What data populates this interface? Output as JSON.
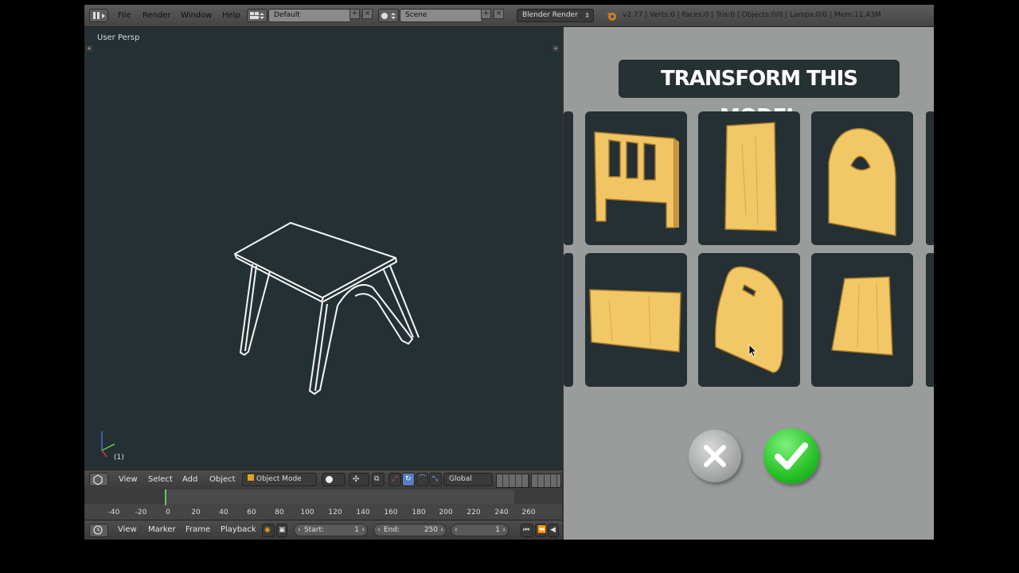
{
  "app": {
    "menus": [
      "File",
      "Render",
      "Window",
      "Help"
    ],
    "screen_layout": "Default",
    "scene": "Scene",
    "render_engine": "Blender Render",
    "stats": "v2.77 | Verts:0 | Faces:0 | Tris:0 | Objects:0/0 | Lamps:0/0 | Mem:11.43M"
  },
  "viewport": {
    "label": "User Persp",
    "frame_indicator": "(1)"
  },
  "header3d": {
    "view": "View",
    "select": "Select",
    "add": "Add",
    "object": "Object",
    "mode": "Object Mode",
    "orientation": "Global"
  },
  "timeline": {
    "ticks": [
      "-40",
      "-20",
      "0",
      "20",
      "40",
      "60",
      "80",
      "100",
      "120",
      "140",
      "160",
      "180",
      "200",
      "220",
      "240",
      "260"
    ],
    "current_frame_value": 0
  },
  "timeline_header": {
    "view": "View",
    "marker": "Marker",
    "frame": "Frame",
    "playback": "Playback",
    "start_label": "Start:",
    "start_value": "1",
    "end_label": "End:",
    "end_value": "250",
    "current_value": "1"
  },
  "panel": {
    "title": "TRANSFORM THIS MODEL",
    "options": [
      {
        "name": "headboard-part"
      },
      {
        "name": "tall-panel-part"
      },
      {
        "name": "arched-panel-with-hole-part"
      },
      {
        "name": "wide-panel-part"
      },
      {
        "name": "rounded-panel-with-slot-part"
      },
      {
        "name": "trapezoid-panel-part"
      }
    ],
    "cancel_icon": "close-icon",
    "confirm_icon": "check-icon",
    "colors": {
      "panel_bg": "#9a9c9c",
      "card_bg": "#243034",
      "wood": "#f0c060",
      "confirm": "#2fbf2f",
      "cancel": "#a8aaaa"
    }
  }
}
